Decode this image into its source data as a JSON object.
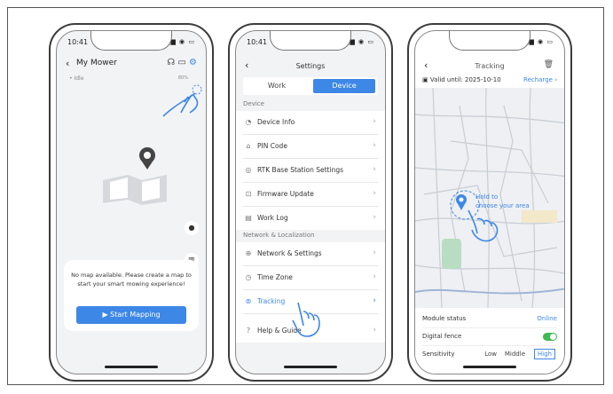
{
  "colors": {
    "accent": "#3d87e6",
    "toggle_on": "#3fb950",
    "background": "#f2f3f5"
  },
  "status": {
    "time": "10:41"
  },
  "phone1": {
    "title": "My Mower",
    "mower_status": "Idle",
    "battery": "80%",
    "empty_message": "No map available. Please create a map to start your smart mowing experience!",
    "start_button": "Start Mapping"
  },
  "phone2": {
    "title": "Settings",
    "tabs": {
      "work": "Work",
      "device": "Device"
    },
    "sections": {
      "device": "Device",
      "network": "Network & Localization"
    },
    "device_items": [
      {
        "label": "Device Info",
        "icon": "robot-icon"
      },
      {
        "label": "PIN Code",
        "icon": "lock-icon"
      },
      {
        "label": "RTK Base Station Settings",
        "icon": "antenna-icon"
      },
      {
        "label": "Firmware Update",
        "icon": "firmware-icon"
      },
      {
        "label": "Work Log",
        "icon": "log-icon"
      }
    ],
    "network_items": [
      {
        "label": "Network & Settings",
        "icon": "globe-icon"
      },
      {
        "label": "Time Zone",
        "icon": "clock-icon"
      },
      {
        "label": "Tracking",
        "icon": "location-icon"
      },
      {
        "label": "Help & Guide",
        "icon": "help-icon"
      }
    ]
  },
  "phone3": {
    "title": "Tracking",
    "valid_until": "Valid until: 2025-10-10",
    "recharge": "Recharge",
    "hold_text_1": "Hold to",
    "hold_text_2": "choose your area",
    "module_status_label": "Module status",
    "module_status_value": "Online",
    "digital_fence_label": "Digital fence",
    "sensitivity_label": "Sensitivity",
    "sensitivity_options": [
      "Low",
      "Middle",
      "High"
    ],
    "sensitivity_selected": "High"
  }
}
